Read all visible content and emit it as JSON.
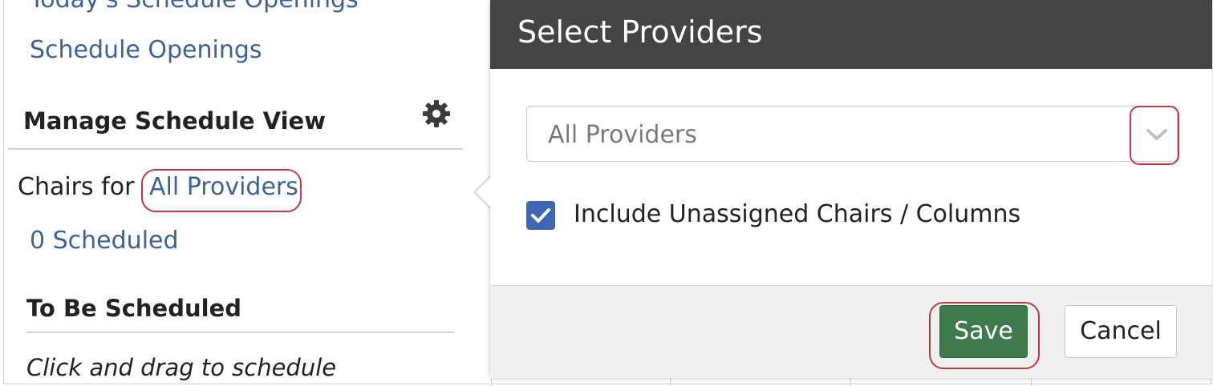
{
  "sidebar": {
    "todays_openings": "Today's Schedule Openings",
    "schedule_openings": "Schedule Openings",
    "manage_heading": "Manage Schedule View",
    "chairs_for": "Chairs for",
    "chairs_provider_link": "All Providers",
    "scheduled_link": "0 Scheduled",
    "to_be_scheduled_heading": "To Be Scheduled",
    "drag_hint": "Click and drag to schedule",
    "gear_icon": "gear-icon"
  },
  "popover": {
    "title": "Select Providers",
    "select_value": "All Providers",
    "chevron_icon": "chevron-down-icon",
    "checkbox_checked": true,
    "checkbox_label": "Include Unassigned Chairs / Columns",
    "save_label": "Save",
    "cancel_label": "Cancel"
  },
  "colors": {
    "link": "#3d6394",
    "header_bg": "#444444",
    "save_bg": "#3d7a4c",
    "checkbox": "#3f67b1",
    "highlight_oval": "#c23a48"
  }
}
